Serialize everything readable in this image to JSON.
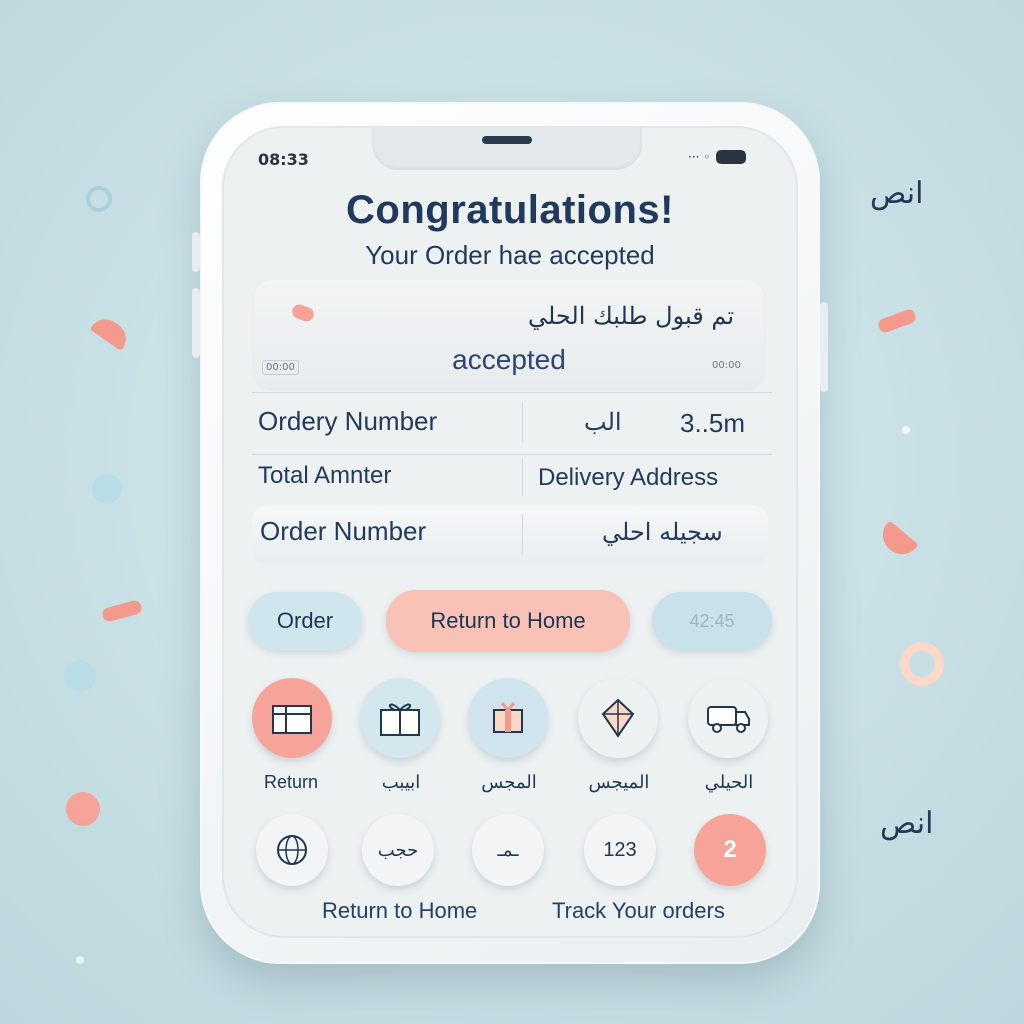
{
  "status_bar": {
    "time": "08:33",
    "signal_glyph": "··· ◦"
  },
  "header": {
    "title": "Congratulations!",
    "subtitle": "Your Order hae accepted"
  },
  "accepted_card": {
    "arabic_line": "تم قبول طلبك الحلي",
    "accepted_text": "accepted",
    "tiny_left": "00:00",
    "tiny_right": "00:00"
  },
  "info": {
    "row1_label": "Ordery Number",
    "row1_arabic": "الب",
    "row1_value": "3..5m",
    "row2_label": "Total  Amnter",
    "row2_value": "Delivery Address",
    "row3_label": "Order Number",
    "row3_value": "سجيله احلي"
  },
  "buttons": {
    "order": "Order",
    "return_home": "Return to Home",
    "third": "42:45"
  },
  "icon_row1": [
    {
      "icon": "gift-box-icon",
      "label": "Return"
    },
    {
      "icon": "gift-ribbon-icon",
      "label": "ابيبب"
    },
    {
      "icon": "present-icon",
      "label": "المجس"
    },
    {
      "icon": "diamond-icon",
      "label": "الميجس"
    },
    {
      "icon": "delivery-truck-icon",
      "label": "الحيلي"
    }
  ],
  "icon_row2": [
    {
      "icon": "globe-icon",
      "text": ""
    },
    {
      "icon": "arabic-text-icon",
      "text": "حجب"
    },
    {
      "icon": "dash-icon",
      "text": "ـمـ"
    },
    {
      "icon": "number-icon",
      "text": "123"
    },
    {
      "icon": "badge-icon",
      "text": "2"
    }
  ],
  "footer": {
    "return_home": "Return to Home",
    "track_orders": "Track Your orders"
  },
  "side_text": {
    "right_top": "انص",
    "right_bottom": "انص"
  },
  "colors": {
    "background": "#c8e0e5",
    "coral": "#f6a49a",
    "light_blue": "#cfe4ec",
    "navy": "#1f3a5c",
    "peach": "#fbd8c8"
  }
}
